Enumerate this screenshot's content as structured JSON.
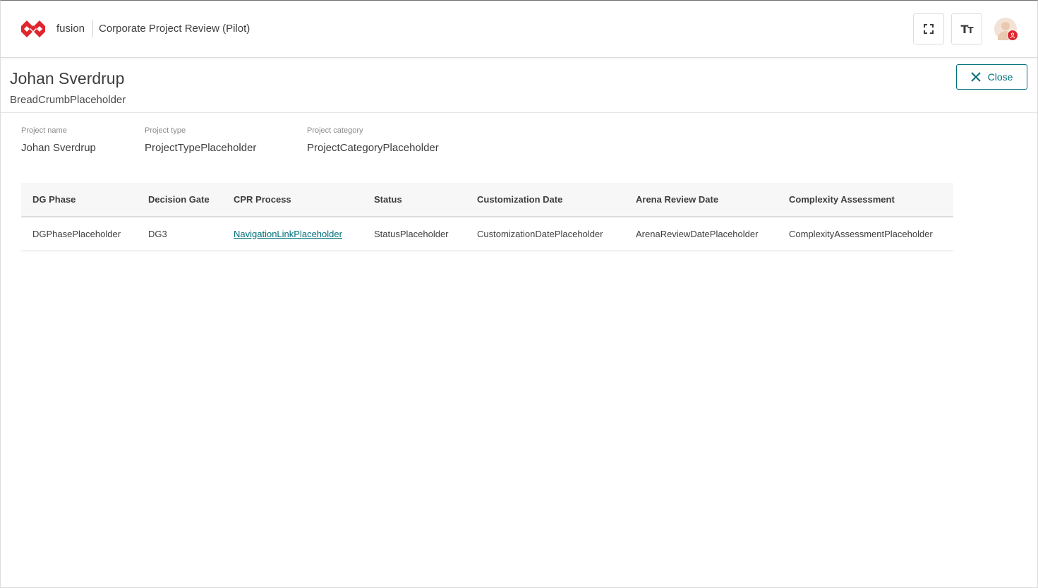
{
  "topbar": {
    "brand": "fusion",
    "app_title": "Corporate Project Review (Pilot)",
    "fullscreen_icon": "fullscreen-icon",
    "text_size_glyph_big": "T",
    "text_size_glyph_small": "T",
    "text_size_icon": "text-size-icon",
    "avatar_icon": "avatar-icon",
    "brand_color": "#e0262d"
  },
  "header": {
    "title": "Johan Sverdrup",
    "breadcrumb": "BreadCrumbPlaceholder",
    "close_label": "Close",
    "close_icon": "close-icon",
    "accent_color": "#007079"
  },
  "fields": [
    {
      "label": "Project name",
      "value": "Johan Sverdrup"
    },
    {
      "label": "Project type",
      "value": "ProjectTypePlaceholder"
    },
    {
      "label": "Project category",
      "value": "ProjectCategoryPlaceholder"
    }
  ],
  "table": {
    "columns": [
      "DG Phase",
      "Decision Gate",
      "CPR Process",
      "Status",
      "Customization Date",
      "Arena Review Date",
      "Complexity Assessment"
    ],
    "rows": [
      [
        "DGPhasePlaceholder",
        "DG3",
        "NavigationLinkPlaceholder",
        "StatusPlaceholder",
        "CustomizationDatePlaceholder",
        "ArenaReviewDatePlaceholder",
        "ComplexityAssessmentPlaceholder"
      ]
    ]
  }
}
